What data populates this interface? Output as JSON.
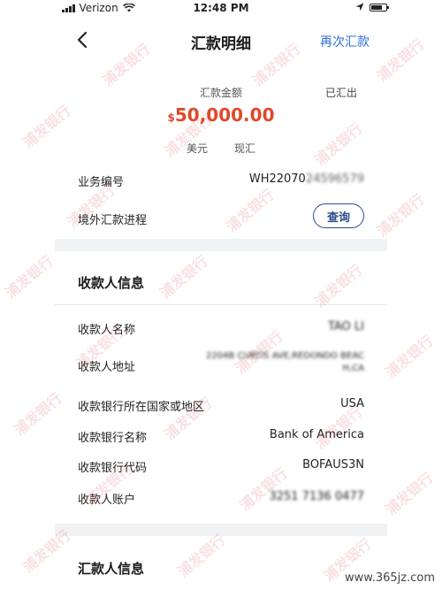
{
  "status_bar": {
    "carrier": "Verizon",
    "time": "12:48 PM"
  },
  "nav": {
    "title": "汇款明细",
    "action": "再次汇款"
  },
  "summary": {
    "amount_label": "汇款金额",
    "status": "已汇出",
    "currency_symbol": "$",
    "amount": "50,000.00",
    "currency": "美元",
    "cash_type": "现汇"
  },
  "business": {
    "number_label": "业务编号",
    "number_value": "WH22070",
    "number_hidden": "24596579",
    "progress_label": "境外汇款进程",
    "query_button": "查询"
  },
  "payee": {
    "section_title": "收款人信息",
    "name_label": "收款人名称",
    "name_value": "TAO LI",
    "address_label": "收款人地址",
    "address_line1": "2204B CURTIS AVE,REDONDO BEAC",
    "address_line2": "H,CA",
    "bank_country_label": "收款银行所在国家或地区",
    "bank_country_value": "USA",
    "bank_name_label": "收款银行名称",
    "bank_name_value": "Bank of America",
    "bank_code_label": "收款银行代码",
    "bank_code_value": "BOFAUS3N",
    "account_label": "收款人账户",
    "account_value": "3251 7136 0477"
  },
  "remitter": {
    "section_title": "汇款人信息"
  },
  "watermark_text": "浦发银行",
  "site_mark": "www.365jz.com"
}
